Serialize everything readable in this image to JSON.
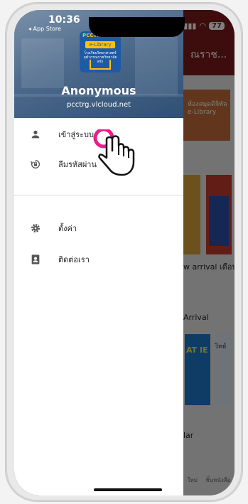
{
  "status_bar": {
    "time": "10:36",
    "back_app": "◂ App Store",
    "battery": "77"
  },
  "drawer": {
    "logo": {
      "top_text": "PCCTRG TRG",
      "main_text": "e-Library",
      "sub_text": "โรงเรียนวิทยาศาสตร์จุฬาภรณราชวิทยาลัย ตรัง"
    },
    "user_name": "Anonymous",
    "host": "pcctrg.vlcloud.net",
    "items": [
      {
        "icon": "person-icon",
        "label": "เข้าสู่ระบบ"
      },
      {
        "icon": "lock-reset-icon",
        "label": "ลืมรหัสผ่าน"
      },
      {
        "icon": "gear-icon",
        "label": "ตั้งค่า"
      },
      {
        "icon": "contact-icon",
        "label": "ติดต่อเรา"
      }
    ]
  },
  "background": {
    "title": "ณราช...",
    "banner_text": "ห้องสมุดดิจิทัล e-Library",
    "section_new_arrival": "w arrival เดือนพ",
    "section_arrival": "Arrival",
    "book_text_1": "AT IE",
    "book_text_2": "วิทย์",
    "section_popular": "lar",
    "tabs": [
      "ใหม่",
      "ชั้นหนังสือ"
    ]
  },
  "colors": {
    "header_red": "#7a1b1b",
    "drawer_header": "#4d6a8c",
    "tap_circle": "#e91e8c"
  }
}
